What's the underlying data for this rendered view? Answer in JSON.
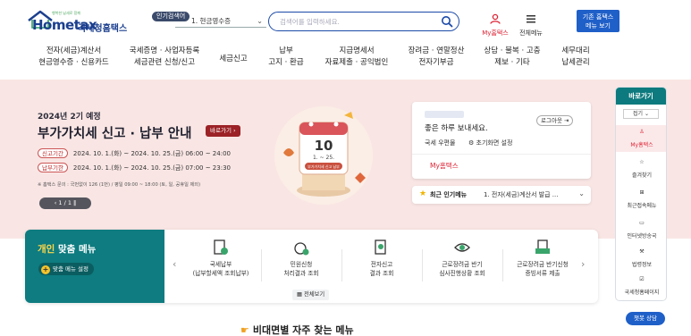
{
  "header": {
    "logo_brand": "Hometax",
    "logo_suffix": "국세청홈택스",
    "logo_tagline": "행복한 납세로 함께",
    "popular_tag": "인기검색어",
    "popular_selected": "1.  현금영수증",
    "search_placeholder": "검색어를 입력하세요.",
    "my_home": "My홈택스",
    "all_menu": "전체메뉴",
    "old_home_line1": "기존 홈택스",
    "old_home_line2": "메뉴 보기"
  },
  "gnb": [
    {
      "l1": "전자(세금)계산서",
      "l2": "현금영수증 · 신용카드"
    },
    {
      "l1": "국세증명 · 사업자등록",
      "l2": "세금관련 신청/신고"
    },
    {
      "l1": "세금신고",
      "l2": ""
    },
    {
      "l1": "납부",
      "l2": "고지 · 환급"
    },
    {
      "l1": "지급명세서",
      "l2": "자료제출 · 공익법인"
    },
    {
      "l1": "장려금 · 연말정산",
      "l2": "전자기부금"
    },
    {
      "l1": "상담 · 불복 · 고충",
      "l2": "제보 · 기타"
    },
    {
      "l1": "세무대리",
      "l2": "납세관리"
    }
  ],
  "hero": {
    "kicker": "2024년 2기 예정",
    "title": "부가가치세 신고 · 납부 안내",
    "go_label": "바로가기",
    "rows": [
      {
        "chip": "신고기간",
        "text": "2024. 10. 1.(화) ~ 2024. 10. 25.(금) 06:00 ~ 24:00"
      },
      {
        "chip": "납부기한",
        "text": "2024. 10. 1.(화) ~ 2024. 10. 25.(금) 07:00 ~ 23:30"
      }
    ],
    "note": "※ 홈택스 문의 : 국번없이 126 (1번) / 평일 09:00 ~ 18:00 (토, 일, 공휴일 제외)",
    "pager": "1 / 1",
    "calendar_day": "10",
    "calendar_range": "1. ~ 25.",
    "calendar_caption": "부가가치세 신고 납부"
  },
  "login": {
    "hello": "좋은 하루 보내세요.",
    "logout": "로그아웃",
    "mailbox": "국세 우편물",
    "init_setting": "초기화면 설정",
    "my_home": "My홈택스"
  },
  "hot_menu": {
    "label": "최근 인기메뉴",
    "item": "1.  전자(세금)계산서 발급 ..."
  },
  "quick": {
    "title": "바로가기",
    "fold": "접기",
    "items": [
      {
        "label": "My홈택스",
        "icon": "person-icon"
      },
      {
        "label": "즐겨찾기",
        "icon": "star-icon"
      },
      {
        "label": "최근접속메뉴",
        "icon": "recent-icon"
      },
      {
        "label": "인터넷방송국",
        "icon": "monitor-icon"
      },
      {
        "label": "법령정보",
        "icon": "gavel-icon"
      },
      {
        "label": "국세청홈페이지",
        "icon": "doc-check-icon"
      }
    ]
  },
  "personal_menu": {
    "title_strong": "개인",
    "title_rest": " 맞춤 메뉴",
    "setting": "맞춤 메뉴 설정",
    "view_all": "전체보기",
    "services": [
      {
        "l1": "국세납부",
        "l2": "(납부할세액 조회납부)"
      },
      {
        "l1": "민원신청",
        "l2": "처리결과 조회"
      },
      {
        "l1": "전자신고",
        "l2": "결과 조회"
      },
      {
        "l1": "근로장려금 반기",
        "l2": "심사진행상황 조회"
      },
      {
        "l1": "근로장려금 반기신청",
        "l2": "증빙서류 제출"
      }
    ]
  },
  "chat_label": "챗봇 상담",
  "bottom_title": "비대면별 자주 찾는 메뉴",
  "colors": {
    "brand_blue": "#1b3f8f",
    "teal": "#0e7c80",
    "hero_bg": "#f9e6e4",
    "accent_red": "#d23"
  }
}
